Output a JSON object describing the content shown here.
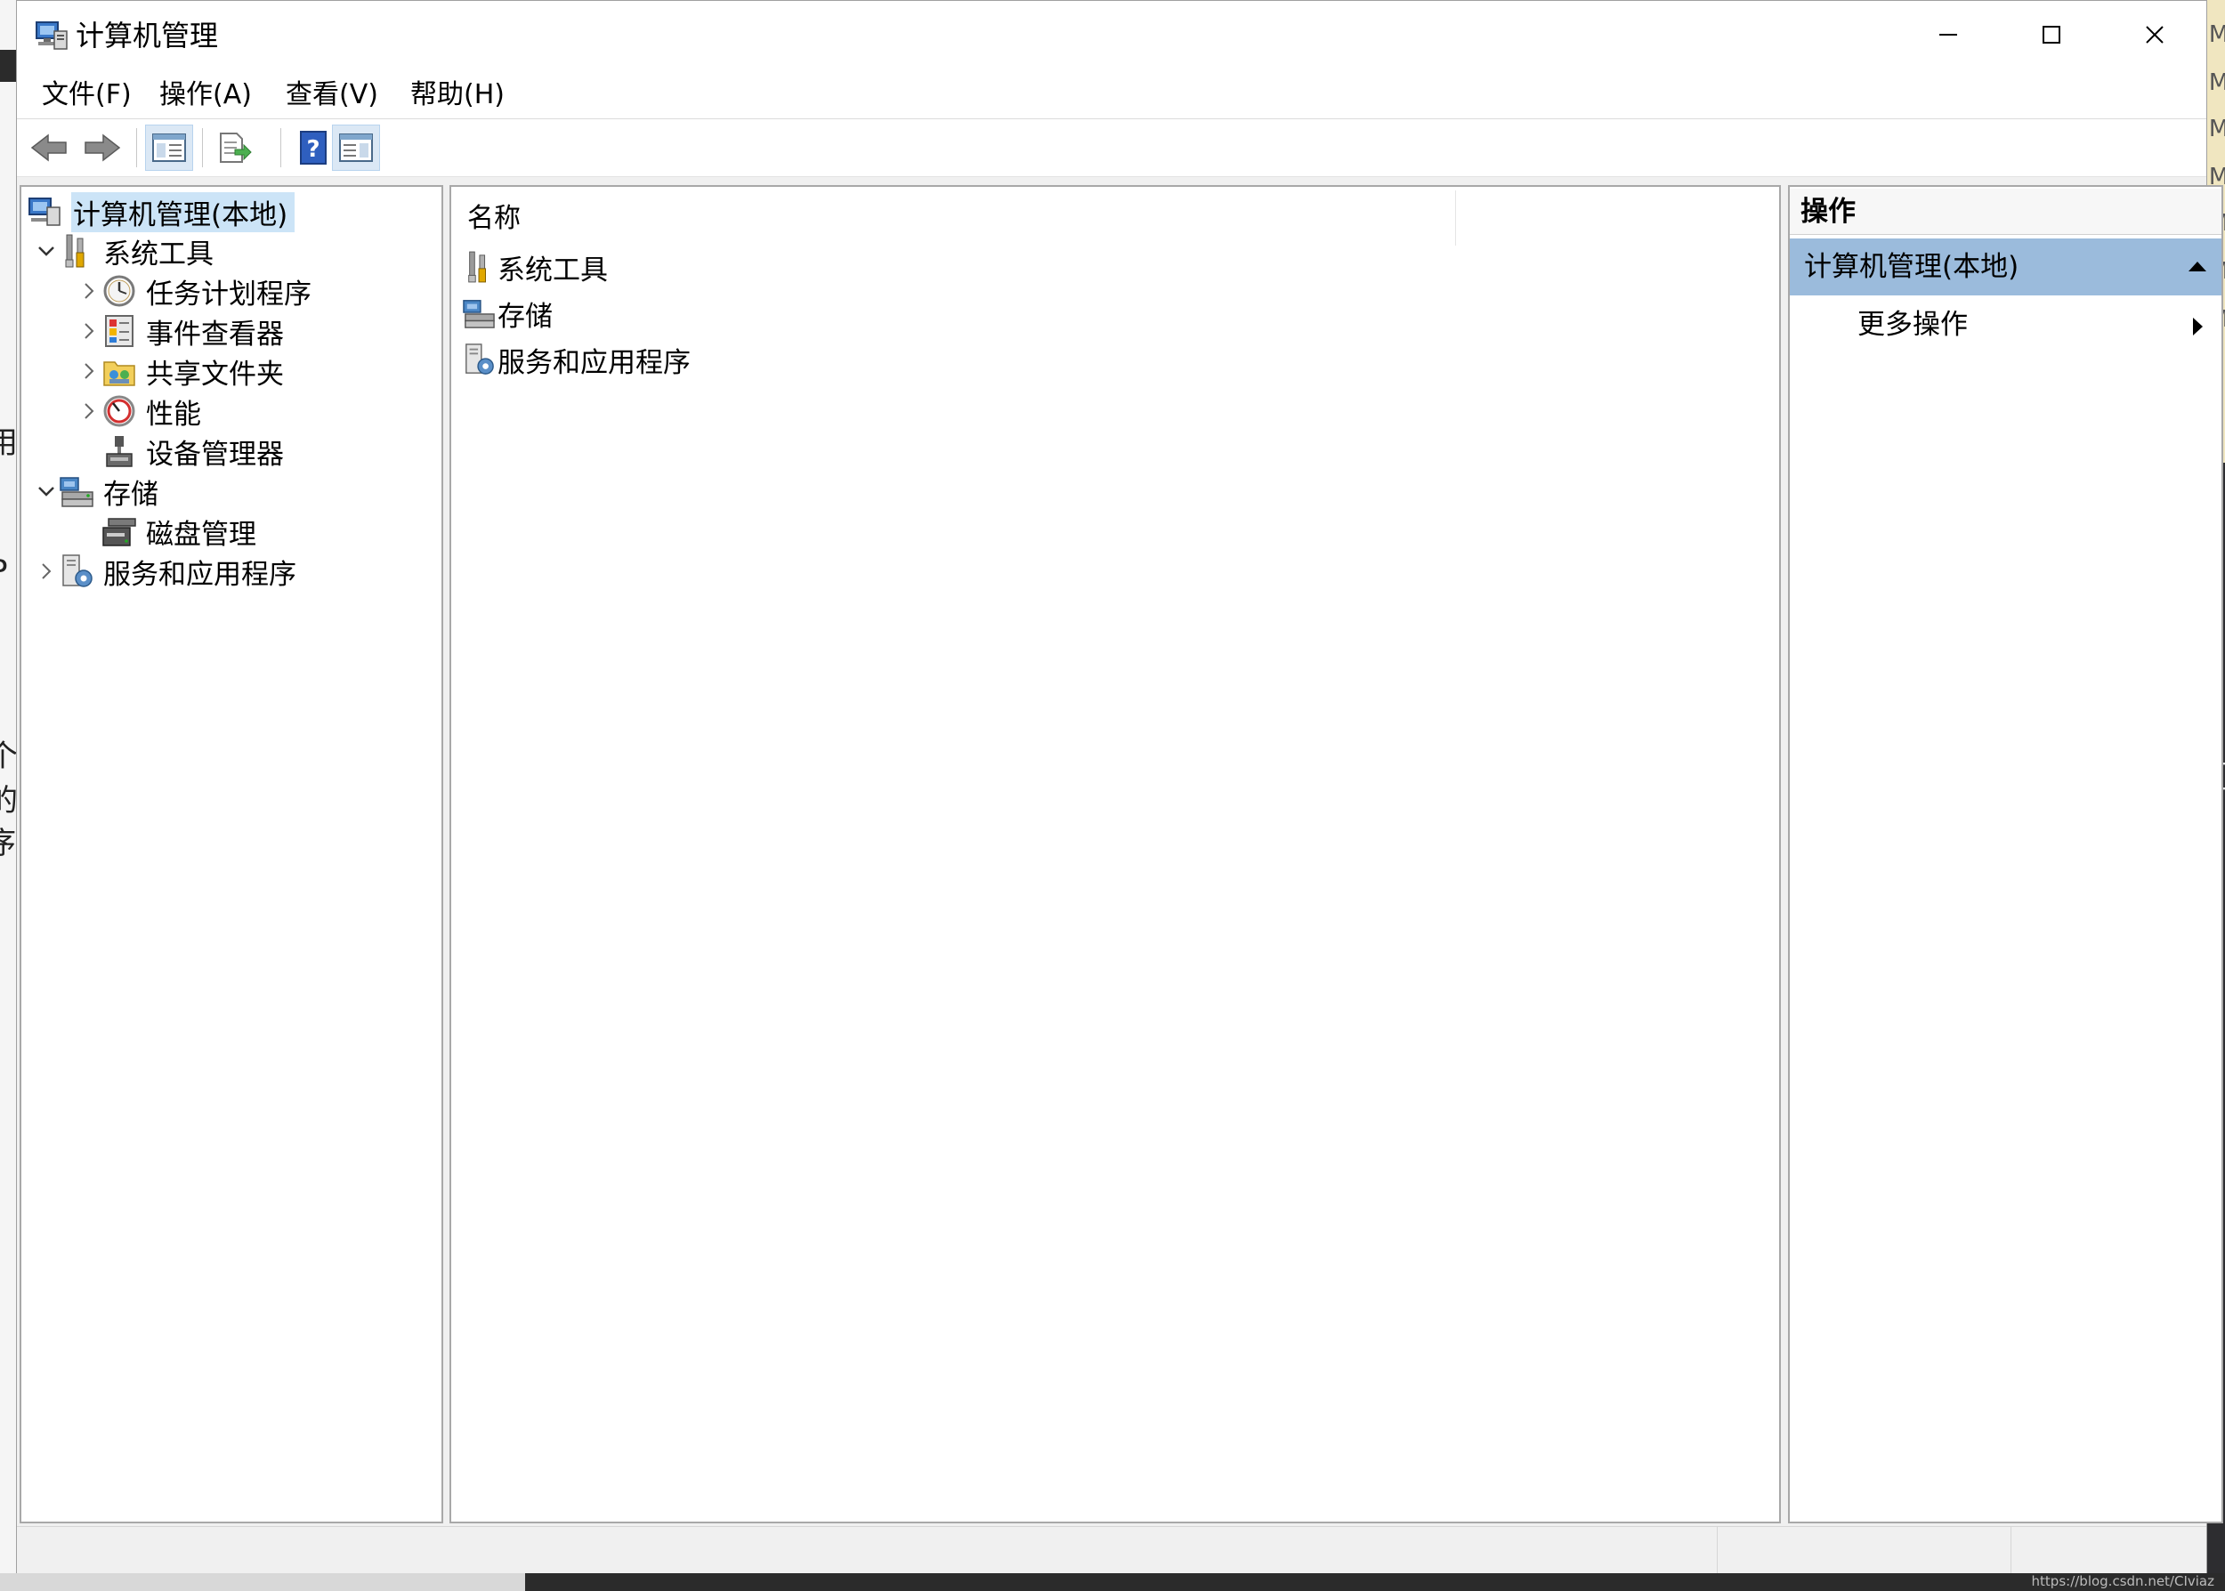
{
  "window": {
    "title": "计算机管理"
  },
  "menu": [
    "文件(F)",
    "操作(A)",
    "查看(V)",
    "帮助(H)"
  ],
  "toolbar": {
    "buttons": [
      "back-icon",
      "forward-icon",
      "show-hide-tree-icon",
      "export-list-icon",
      "help-icon",
      "show-hide-action-pane-icon"
    ]
  },
  "tree": {
    "root": "计算机管理(本地)",
    "system_tools": "系统工具",
    "task_scheduler": "任务计划程序",
    "event_viewer": "事件查看器",
    "shared_folders": "共享文件夹",
    "performance": "性能",
    "device_manager": "设备管理器",
    "storage": "存储",
    "disk_management": "磁盘管理",
    "services_apps": "服务和应用程序"
  },
  "list": {
    "column_name": "名称",
    "items": [
      "系统工具",
      "存储",
      "服务和应用程序"
    ]
  },
  "actions": {
    "title": "操作",
    "section": "计算机管理(本地)",
    "more": "更多操作"
  },
  "background": {
    "watermark": "https://blog.csdn.net/CIviaz",
    "edge_chars_left": [
      "用",
      "P",
      "个",
      "的",
      "序"
    ],
    "edge_chars_right": [
      "MI",
      "MI",
      "MI",
      "MI",
      "MI",
      "MI",
      "MI",
      "]"
    ]
  },
  "colors": {
    "selection": "#cce4f7",
    "action_header": "#9bbbdc",
    "pane_border": "#a8a8a8"
  }
}
